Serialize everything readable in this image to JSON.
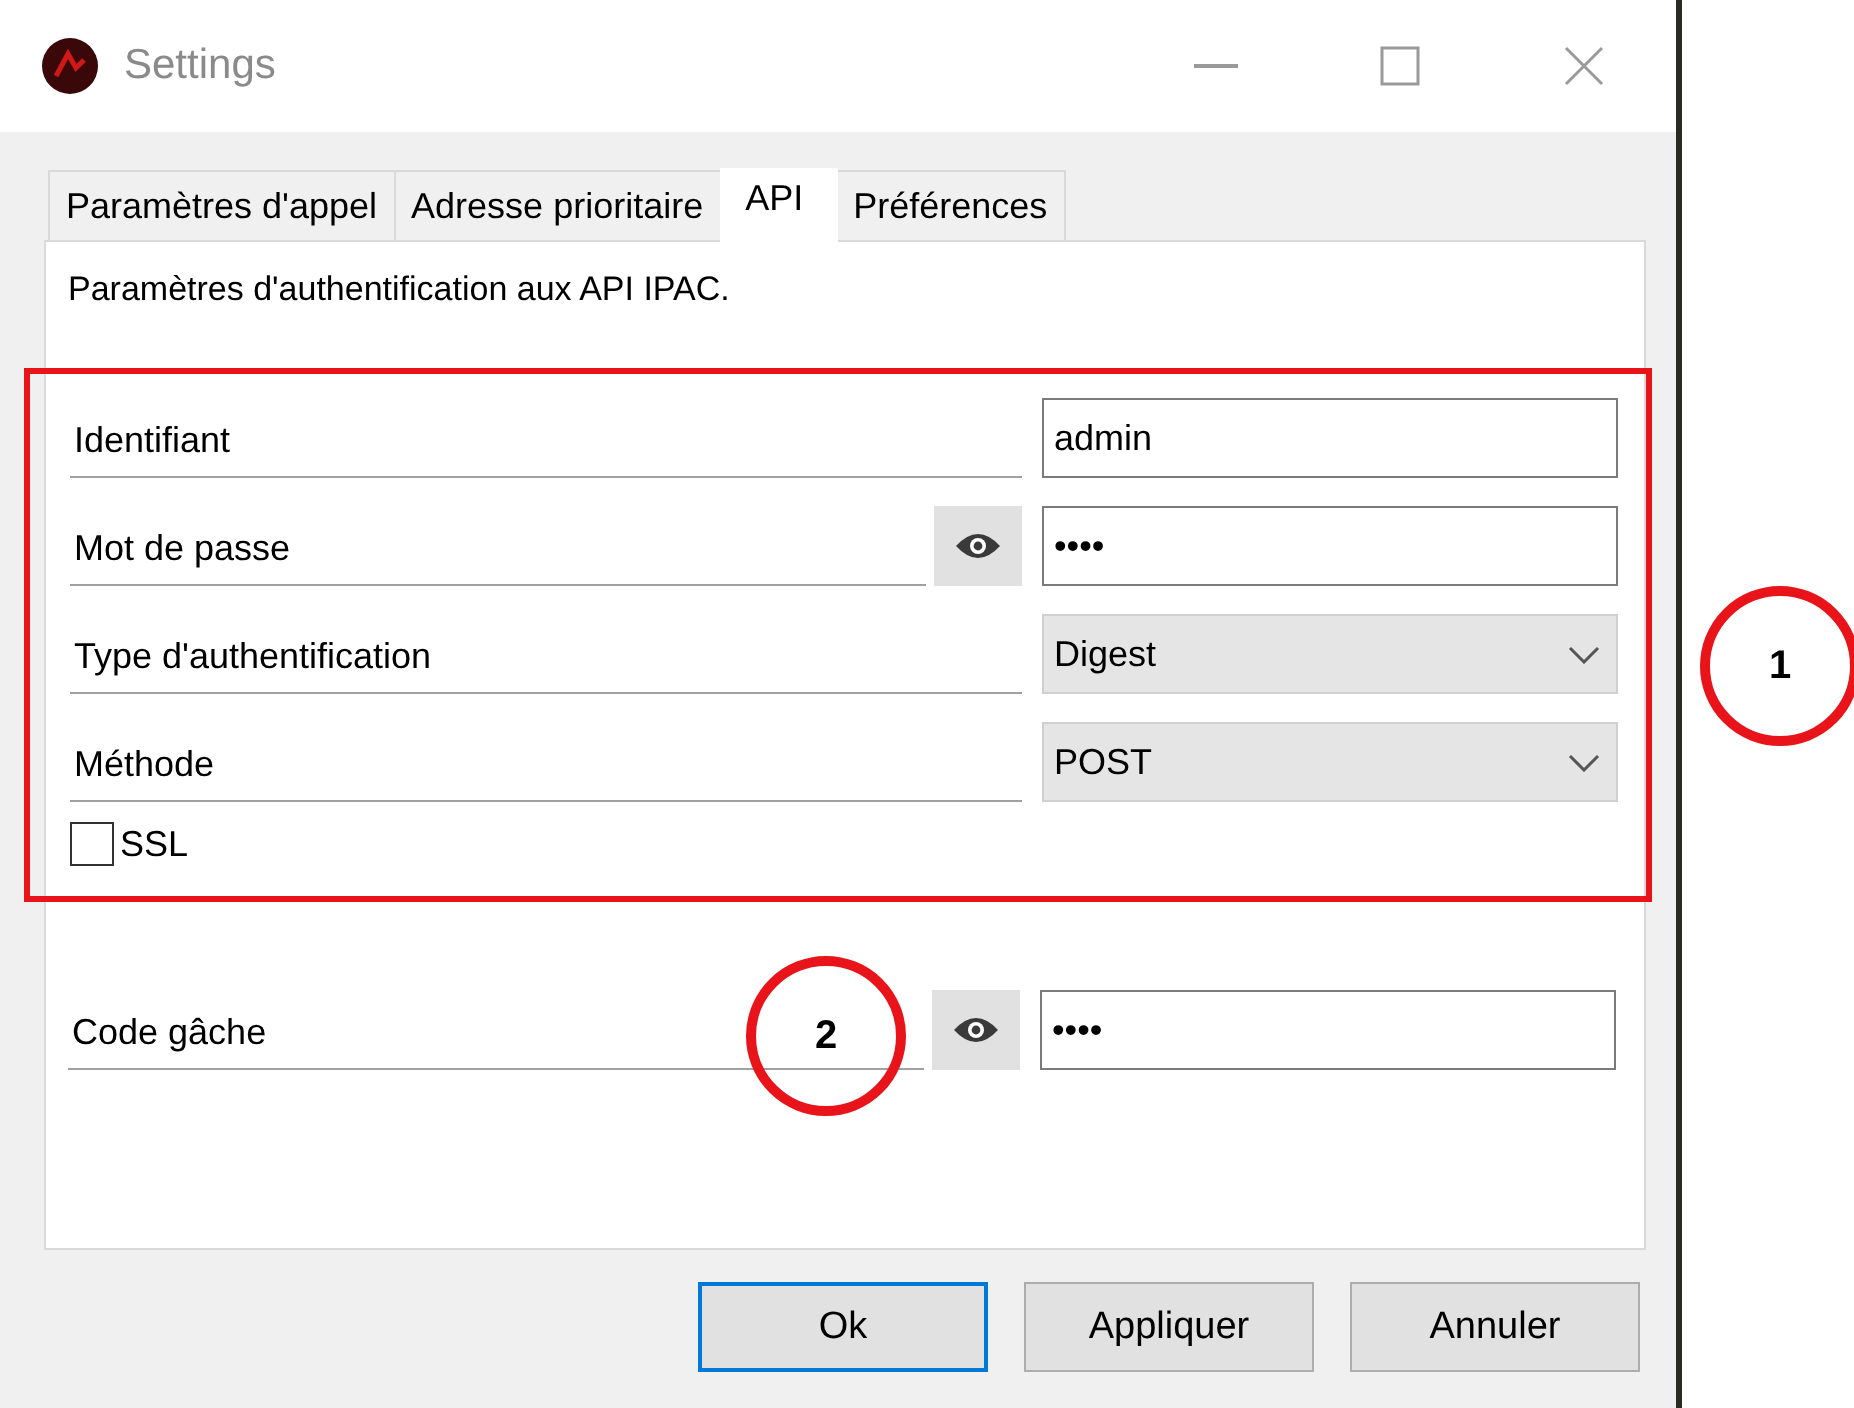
{
  "window": {
    "title": "Settings"
  },
  "tabs": [
    {
      "label": "Paramètres d'appel",
      "selected": false
    },
    {
      "label": "Adresse prioritaire",
      "selected": false
    },
    {
      "label": "API",
      "selected": true
    },
    {
      "label": "Préférences",
      "selected": false
    }
  ],
  "description": "Paramètres d'authentification aux API IPAC.",
  "fields": [
    {
      "kind": "text",
      "label": "Identifiant",
      "value": "admin"
    },
    {
      "kind": "password",
      "label": "Mot de passe",
      "value": "••••"
    },
    {
      "kind": "select",
      "label": "Type d'authentification",
      "value": "Digest"
    },
    {
      "kind": "select",
      "label": "Méthode",
      "value": "POST"
    },
    {
      "kind": "checkbox",
      "label": "SSL",
      "checked": false
    }
  ],
  "trigger_code": {
    "kind": "password",
    "label": "Code gâche",
    "value": "••••"
  },
  "buttons": [
    {
      "label": "Ok",
      "default": true
    },
    {
      "label": "Appliquer",
      "default": false
    },
    {
      "label": "Annuler",
      "default": false
    }
  ],
  "annotations": [
    "1",
    "2"
  ]
}
